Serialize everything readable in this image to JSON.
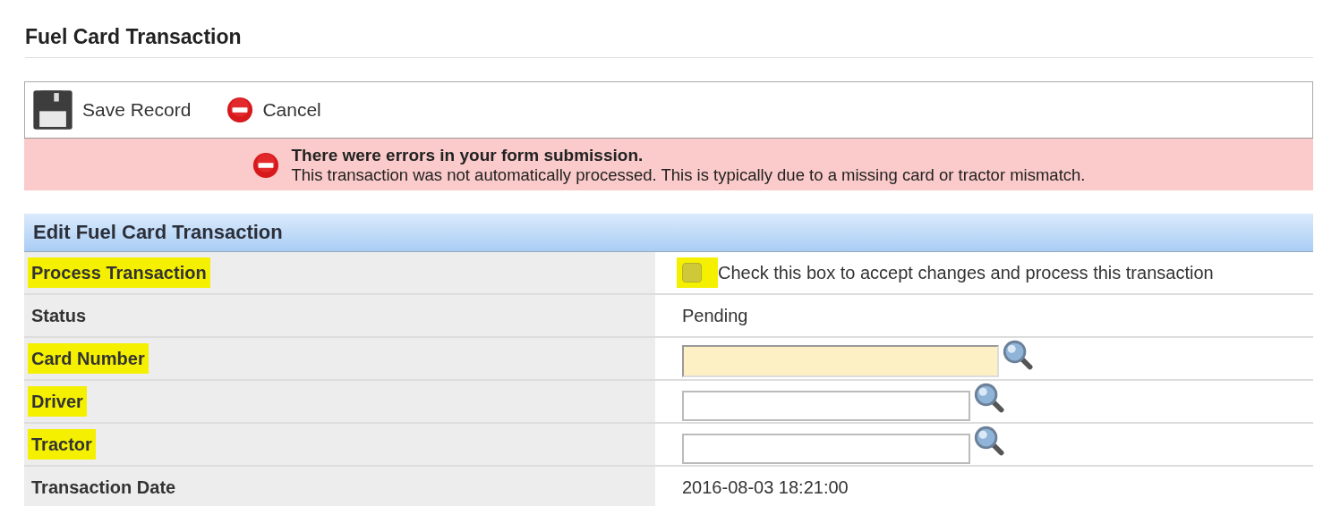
{
  "page_title": "Fuel Card Transaction",
  "toolbar": [
    {
      "kind": "save",
      "label": "Save Record"
    },
    {
      "kind": "cancel",
      "label": "Cancel"
    }
  ],
  "error": {
    "heading": "There were errors in your form submission.",
    "message": "This transaction was not automatically processed. This is typically due to a missing card or tractor mismatch."
  },
  "section": {
    "title": "Edit Fuel Card Transaction",
    "rows": [
      {
        "label": "Process Transaction",
        "highlighted": true,
        "kind": "checkbox",
        "checked": false,
        "checkbox_highlighted": true,
        "text": "Check this box to accept changes and process this transaction"
      },
      {
        "label": "Status",
        "highlighted": false,
        "kind": "text",
        "text": "Pending"
      },
      {
        "label": "Card Number",
        "highlighted": true,
        "kind": "lookup",
        "invalid": true
      },
      {
        "label": "Driver",
        "highlighted": true,
        "kind": "lookup",
        "invalid": false
      },
      {
        "label": "Tractor",
        "highlighted": true,
        "kind": "lookup",
        "invalid": false
      },
      {
        "label": "Transaction Date",
        "highlighted": false,
        "kind": "text",
        "text": "2016-08-03 18:21:00"
      }
    ]
  }
}
